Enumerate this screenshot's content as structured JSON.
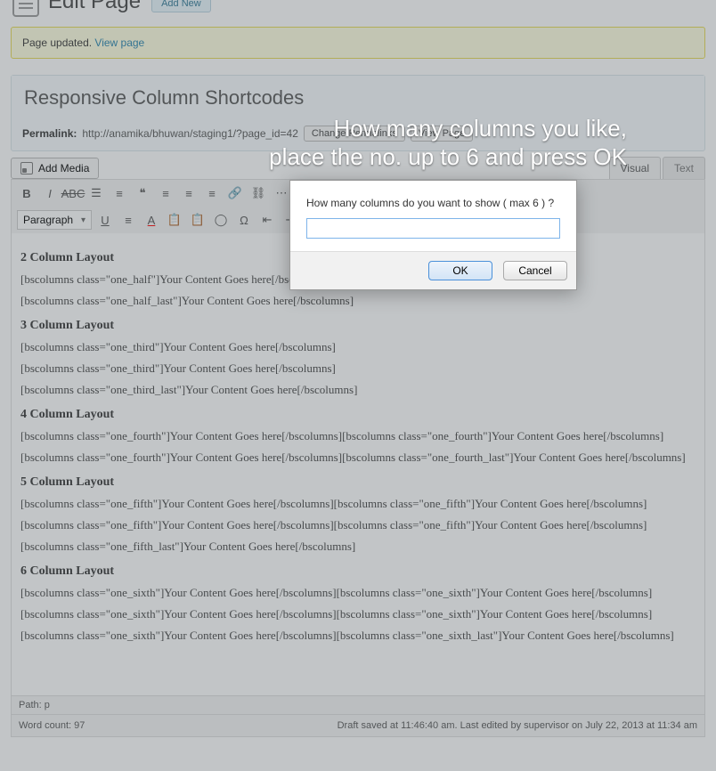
{
  "header": {
    "title": "Edit Page",
    "add_new": "Add New"
  },
  "notice": {
    "text": "Page updated. ",
    "link": "View page"
  },
  "post": {
    "title": "Responsive Column Shortcodes",
    "permalink_label": "Permalink:",
    "permalink_url": "http://anamika/bhuwan/staging1/?page_id=42",
    "change_permalinks": "Change Permalinks",
    "view_page": "View Page"
  },
  "media": {
    "add_media": "Add Media"
  },
  "tabs": {
    "visual": "Visual",
    "text": "Text"
  },
  "toolbar": {
    "paragraph": "Paragraph"
  },
  "dialog": {
    "prompt": "How many columns do you want to show ( max 6 ) ?",
    "value": "",
    "ok": "OK",
    "cancel": "Cancel"
  },
  "overlay": {
    "line1": "How many columns you like,",
    "line2": "place the no. up to 6 and press OK"
  },
  "content": {
    "h2": "2 Column Layout",
    "l2a": "[bscolumns class=\"one_half\"]Your Content Goes here[/bscolumns]",
    "l2b": "[bscolumns class=\"one_half_last\"]Your Content Goes here[/bscolumns]",
    "h3": "3 Column Layout",
    "l3a": "[bscolumns class=\"one_third\"]Your Content Goes here[/bscolumns]",
    "l3b": "[bscolumns class=\"one_third\"]Your Content Goes here[/bscolumns]",
    "l3c": "[bscolumns class=\"one_third_last\"]Your Content Goes here[/bscolumns]",
    "h4": "4 Column Layout",
    "l4": "[bscolumns class=\"one_fourth\"]Your Content Goes here[/bscolumns][bscolumns class=\"one_fourth\"]Your Content Goes here[/bscolumns][bscolumns class=\"one_fourth\"]Your Content Goes here[/bscolumns][bscolumns class=\"one_fourth_last\"]Your Content Goes here[/bscolumns]",
    "h5": "5 Column Layout",
    "l5": "[bscolumns class=\"one_fifth\"]Your Content Goes here[/bscolumns][bscolumns class=\"one_fifth\"]Your Content Goes here[/bscolumns] [bscolumns class=\"one_fifth\"]Your Content Goes here[/bscolumns][bscolumns class=\"one_fifth\"]Your Content Goes here[/bscolumns] [bscolumns class=\"one_fifth_last\"]Your Content Goes here[/bscolumns]",
    "h6": "6 Column Layout",
    "l6": "[bscolumns class=\"one_sixth\"]Your Content Goes here[/bscolumns][bscolumns class=\"one_sixth\"]Your Content Goes here[/bscolumns] [bscolumns class=\"one_sixth\"]Your Content Goes here[/bscolumns][bscolumns class=\"one_sixth\"]Your Content Goes here[/bscolumns] [bscolumns class=\"one_sixth\"]Your Content Goes here[/bscolumns][bscolumns class=\"one_sixth_last\"]Your Content Goes here[/bscolumns]"
  },
  "footer": {
    "path": "Path: p",
    "wordcount": "Word count: 97",
    "status": "Draft saved at 11:46:40 am. Last edited by supervisor on July 22, 2013 at 11:34 am"
  }
}
